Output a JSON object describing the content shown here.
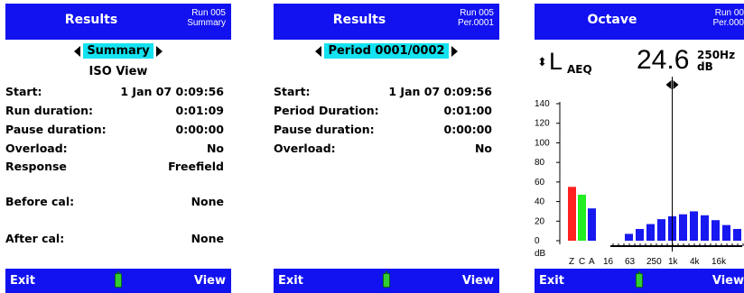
{
  "screen1": {
    "header": {
      "title": "Results",
      "run": "Run 005",
      "sub": "Summary"
    },
    "selector": "Summary",
    "subtitle": "ISO View",
    "rows": [
      {
        "label": "Start:",
        "value": "1 Jan 07  0:09:56"
      },
      {
        "label": "Run duration:",
        "value": "0:01:09"
      },
      {
        "label": "Pause duration:",
        "value": "0:00:00"
      },
      {
        "label": "Overload:",
        "value": "No"
      },
      {
        "label": "Response",
        "value": "Freefield"
      },
      {
        "label": "Before cal:",
        "value": "None"
      },
      {
        "label": "After cal:",
        "value": "None"
      }
    ],
    "footer": {
      "left": "Exit",
      "right": "View"
    }
  },
  "screen2": {
    "header": {
      "title": "Results",
      "run": "Run 005",
      "sub": "Per.0001"
    },
    "selector": "Period 0001/0002",
    "rows": [
      {
        "label": "Start:",
        "value": "1 Jan 07  0:09:56"
      },
      {
        "label": "Period Duration:",
        "value": "0:01:00"
      },
      {
        "label": "Pause duration:",
        "value": "0:00:00"
      },
      {
        "label": "Overload:",
        "value": "No"
      }
    ],
    "footer": {
      "left": "Exit",
      "right": "View"
    }
  },
  "screen3": {
    "header": {
      "title": "Octave",
      "run": "Run 00",
      "sub": "Per.000"
    },
    "measure": {
      "letter": "L",
      "sub": "AEQ"
    },
    "value": "24.6",
    "freq": "250Hz",
    "unit": "dB",
    "footer": {
      "left": "Exit",
      "right": "View"
    },
    "colors": {
      "z": "#ff2020",
      "c": "#22ee22",
      "a": "#1818f0",
      "band": "#1818f0"
    }
  },
  "chart_data": {
    "type": "bar",
    "ylabel": "dB",
    "ylim": [
      0,
      140
    ],
    "y_ticks": [
      "140",
      "120",
      "100",
      "80",
      "60",
      "40",
      "20",
      "0"
    ],
    "weighting_categories": [
      "Z",
      "C",
      "A"
    ],
    "weighting_values": [
      55,
      47,
      33
    ],
    "band_values": [
      7,
      12,
      17,
      22,
      25,
      27,
      30,
      26,
      21,
      16,
      12,
      9
    ],
    "x_tick_labels": [
      "16",
      "63",
      "250",
      "1k",
      "4k",
      "16k"
    ],
    "cursor_band_index": 4
  }
}
